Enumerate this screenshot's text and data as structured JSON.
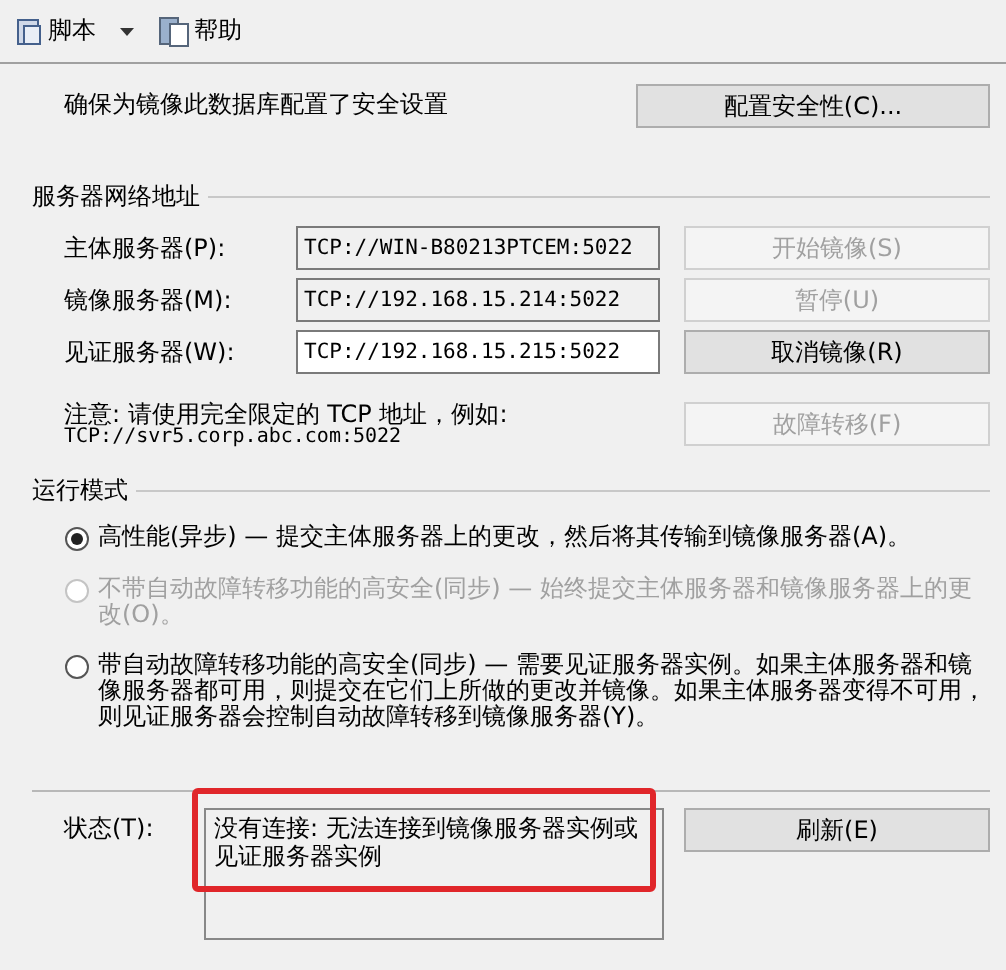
{
  "toolbar": [
    {
      "label": "脚本",
      "kind": "script",
      "dropdown": true
    },
    {
      "label": "帮助",
      "kind": "help",
      "dropdown": false
    }
  ],
  "security": {
    "text": "确保为镜像此数据库配置了安全设置",
    "button": {
      "label": "配置安全性(C)...",
      "disabled": false
    }
  },
  "server_addresses": {
    "title": "服务器网络地址",
    "rows": [
      {
        "label": "主体服务器(P):",
        "value": "TCP://WIN-B80213PTCEM:5022",
        "readonly": true,
        "button": {
          "label": "开始镜像(S)",
          "disabled": true
        }
      },
      {
        "label": "镜像服务器(M):",
        "value": "TCP://192.168.15.214:5022",
        "readonly": true,
        "button": {
          "label": "暂停(U)",
          "disabled": true
        }
      },
      {
        "label": "见证服务器(W):",
        "value": "TCP://192.168.15.215:5022",
        "readonly": false,
        "button": {
          "label": "取消镜像(R)",
          "disabled": false
        }
      }
    ],
    "note": "注意: 请使用完全限定的 TCP 地址，例如:",
    "example": "TCP://svr5.corp.abc.com:5022",
    "failover_button": {
      "label": "故障转移(F)",
      "disabled": true
    }
  },
  "operating_mode": {
    "title": "运行模式",
    "options": [
      {
        "label": "高性能(异步) — 提交主体服务器上的更改，然后将其传输到镜像服务器(A)。",
        "selected": true,
        "disabled": false
      },
      {
        "label": "不带自动故障转移功能的高安全(同步) — 始终提交主体服务器和镜像服务器上的更改(O)。",
        "selected": false,
        "disabled": true
      },
      {
        "label": "带自动故障转移功能的高安全(同步) — 需要见证服务器实例。如果主体服务器和镜像服务器都可用，则提交在它们上所做的更改并镜像。如果主体服务器变得不可用，则见证服务器会控制自动故障转移到镜像服务器(Y)。",
        "selected": false,
        "disabled": false
      }
    ]
  },
  "status": {
    "label": "状态(T):",
    "value": "没有连接: 无法连接到镜像服务器实例或见证服务器实例",
    "highlighted": true,
    "button": {
      "label": "刷新(E)",
      "disabled": false
    }
  }
}
